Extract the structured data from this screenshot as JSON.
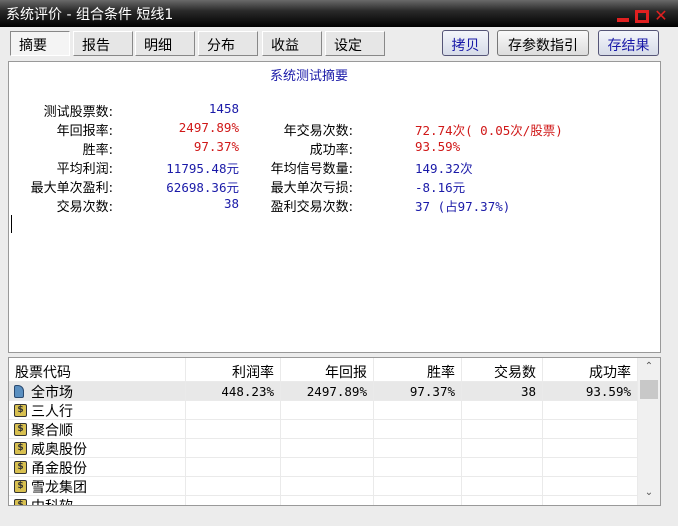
{
  "window": {
    "title": "系统评价 - 组合条件 短线1"
  },
  "tabs": [
    "摘要",
    "报告",
    "明细",
    "分布",
    "收益",
    "设定"
  ],
  "buttons": {
    "copy": "拷贝",
    "save_params": "存参数指引",
    "save_results": "存结果"
  },
  "summary": {
    "title": "系统测试摘要",
    "left": [
      {
        "label": "测试股票数:",
        "value": "1458",
        "color": "blue"
      },
      {
        "label": "年回报率:",
        "value": "2497.89%",
        "color": "red"
      },
      {
        "label": "胜率:",
        "value": "97.37%",
        "color": "red"
      },
      {
        "label": "平均利润:",
        "value": "11795.48元",
        "color": "blue"
      },
      {
        "label": "最大单次盈利:",
        "value": "62698.36元",
        "color": "blue"
      },
      {
        "label": "交易次数:",
        "value": "38",
        "color": "blue"
      }
    ],
    "right": [
      {
        "label": "年交易次数:",
        "value": "72.74次(  0.05次/股票)",
        "color": "red"
      },
      {
        "label": "成功率:",
        "value": "93.59%",
        "color": "red"
      },
      {
        "label": "年均信号数量:",
        "value": "149.32次",
        "color": "blue"
      },
      {
        "label": "最大单次亏损:",
        "value": "-8.16元",
        "color": "blue"
      },
      {
        "label": "盈利交易次数:",
        "value": "37 (占97.37%)",
        "color": "blue"
      }
    ]
  },
  "table": {
    "columns": [
      "股票代码",
      "利润率",
      "年回报",
      "胜率",
      "交易数",
      "成功率"
    ],
    "rows": [
      [
        "全市场",
        "448.23%",
        "2497.89%",
        "97.37%",
        "38",
        "93.59%"
      ],
      [
        "三人行",
        "",
        "",
        "",
        "",
        ""
      ],
      [
        "聚合顺",
        "",
        "",
        "",
        "",
        ""
      ],
      [
        "威奥股份",
        "",
        "",
        "",
        "",
        ""
      ],
      [
        "甬金股份",
        "",
        "",
        "",
        "",
        ""
      ],
      [
        "雪龙集团",
        "",
        "",
        "",
        "",
        ""
      ],
      [
        "中科软",
        "",
        "",
        "",
        "",
        ""
      ]
    ]
  }
}
